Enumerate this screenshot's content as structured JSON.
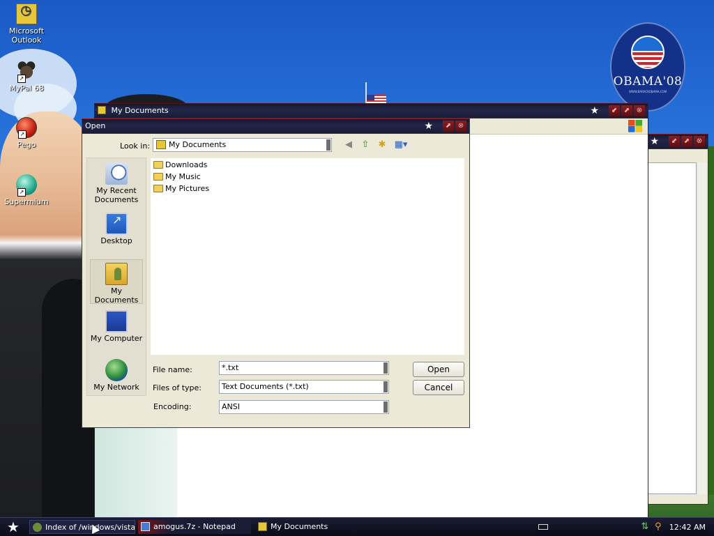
{
  "desktop": {
    "icons": [
      {
        "label": "Microsoft Outlook",
        "icon": "outlook-icon"
      },
      {
        "label": "MyPal 68",
        "icon": "mypal-icon"
      },
      {
        "label": "Pego",
        "icon": "pego-icon"
      },
      {
        "label": "Supermium",
        "icon": "supermium-icon"
      }
    ],
    "wallpaper_badge": {
      "text": "OBAMA'08",
      "url": "WWW.BARACKOBAMA.COM"
    }
  },
  "explorer_window": {
    "title": "My Documents"
  },
  "notepad_window": {
    "title": ""
  },
  "open_dialog": {
    "title": "Open",
    "look_in_label": "Look in:",
    "look_in_value": "My Documents",
    "places": [
      {
        "label": "My Recent Documents",
        "icon": "recent-documents-icon"
      },
      {
        "label": "Desktop",
        "icon": "desktop-icon"
      },
      {
        "label": "My Documents",
        "icon": "my-documents-icon"
      },
      {
        "label": "My Computer",
        "icon": "my-computer-icon"
      },
      {
        "label": "My Network",
        "icon": "my-network-icon"
      }
    ],
    "files": [
      "Downloads",
      "My Music",
      "My Pictures"
    ],
    "file_name_label": "File name:",
    "file_name_value": "*.txt",
    "files_of_type_label": "Files of type:",
    "files_of_type_value": "Text Documents (*.txt)",
    "encoding_label": "Encoding:",
    "encoding_value": "ANSI",
    "open_button": "Open",
    "cancel_button": "Cancel"
  },
  "taskbar": {
    "tasks": [
      {
        "label": "Index of /windows/vista/ -",
        "icon": "browser-icon"
      },
      {
        "label": "amogus.7z - Notepad",
        "icon": "notepad-icon"
      },
      {
        "label": "My Documents",
        "icon": "folder-icon"
      }
    ],
    "clock": "12:42 AM"
  },
  "colors": {
    "titlebar": "#1a1c36",
    "accent_red": "#8b1c20",
    "dialog_bg": "#ece9d8"
  }
}
